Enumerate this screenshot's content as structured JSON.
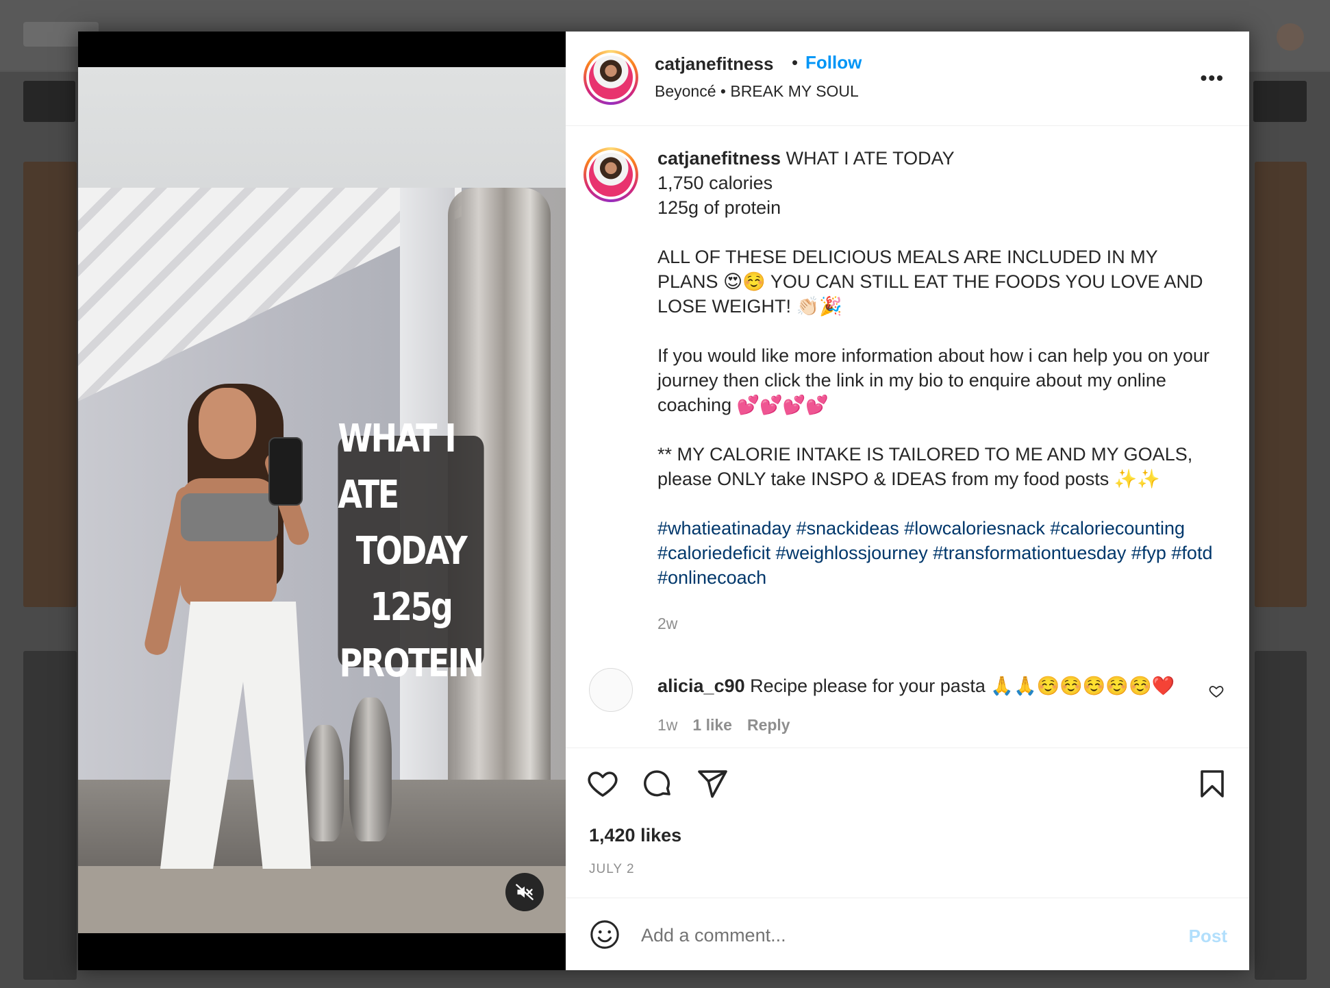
{
  "post": {
    "username": "catjanefitness",
    "separator": "•",
    "follow_label": "Follow",
    "audio_artist": "Beyoncé",
    "audio_dot": "•",
    "audio_title": "BREAK MY SOUL",
    "more_label": "•••"
  },
  "media": {
    "sticker_lines": [
      "WHAT I ATE",
      "TODAY",
      "125g",
      "PROTEIN"
    ],
    "mute_icon": "speaker-muted-icon"
  },
  "caption": {
    "username": "catjanefitness",
    "line1": "WHAT I ATE TODAY",
    "line2": "1,750 calories",
    "line3": "125g of protein",
    "para2": "ALL OF THESE DELICIOUS MEALS ARE INCLUDED IN MY PLANS 😍☺️ YOU CAN STILL EAT THE FOODS YOU LOVE AND LOSE WEIGHT! 👏🏻🎉",
    "para3": "If you would like more information about how i can help you on your journey then click the link in my bio to enquire about my online coaching 💕💕💕💕",
    "para4": "** MY CALORIE INTAKE IS TAILORED TO ME AND MY GOALS, please ONLY take INSPO & IDEAS from my food posts ✨✨",
    "hashtags": "#whatieatinaday #snackideas #lowcaloriesnack #caloriecounting #caloriedeficit #weighlossjourney #transformationtuesday #fyp #fotd #onlinecoach",
    "time": "2w"
  },
  "comment": {
    "username": "alicia_c90",
    "text": "Recipe please for your pasta 🙏🙏☺️☺️☺️☺️☺️❤️",
    "time": "1w",
    "likes": "1 like",
    "reply_label": "Reply"
  },
  "actions": {
    "likes": "1,420 likes",
    "date": "JULY 2"
  },
  "add_comment": {
    "placeholder": "Add a comment...",
    "post_label": "Post"
  },
  "colors": {
    "follow_blue": "#0095f6",
    "hashtag_blue": "#00376b",
    "post_disabled": "#b2dffc"
  }
}
